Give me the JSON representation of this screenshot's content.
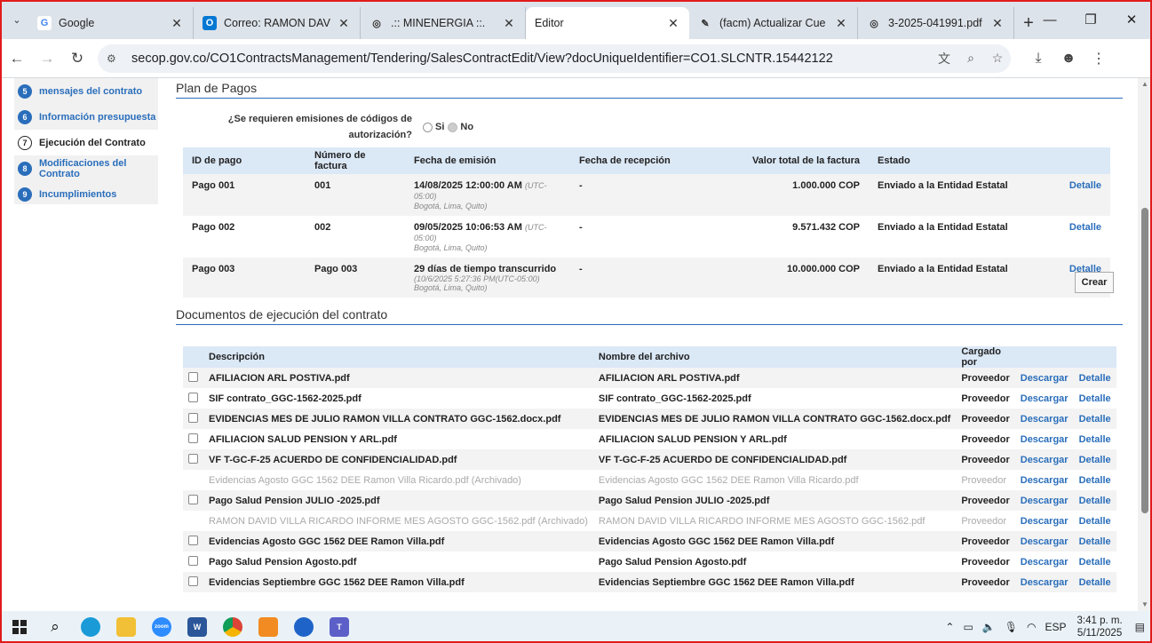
{
  "browser": {
    "tabs": [
      {
        "title": "Google",
        "favicon": "google-icon",
        "active": false
      },
      {
        "title": "Correo: RAMON DAV",
        "favicon": "outlook-icon",
        "active": false
      },
      {
        "title": ".:: MINENERGIA ::.",
        "favicon": "globe-icon",
        "active": false
      },
      {
        "title": "Editor",
        "favicon": "",
        "active": true
      },
      {
        "title": "(facm) Actualizar Cue",
        "favicon": "feather-icon",
        "active": false
      },
      {
        "title": "3-2025-041991.pdf",
        "favicon": "globe-icon",
        "active": false
      }
    ],
    "url": "secop.gov.co/CO1ContractsManagement/Tendering/SalesContractEdit/View?docUniqueIdentifier=CO1.SLCNTR.15442122"
  },
  "sidebar": {
    "steps": [
      {
        "num": "5",
        "label": "mensajes del contrato",
        "current": false
      },
      {
        "num": "6",
        "label": "Información presupuesta",
        "current": false
      },
      {
        "num": "7",
        "label": "Ejecución del Contrato",
        "current": true
      },
      {
        "num": "8",
        "label": "Modificaciones del Contrato",
        "current": false
      },
      {
        "num": "9",
        "label": "Incumplimientos",
        "current": false
      }
    ]
  },
  "plan_pagos": {
    "title": "Plan de Pagos",
    "question_line1": "¿Se requieren emisiones de códigos de",
    "question_line2": "autorización?",
    "opt_si": "Si",
    "opt_no": "No",
    "headers": [
      "ID de pago",
      "Número de factura",
      "Fecha de emisión",
      "Fecha de recepción",
      "Valor total de la factura",
      "Estado"
    ],
    "rows": [
      {
        "id": "Pago 001",
        "factura": "001",
        "fecha": "14/08/2025 12:00:00 AM",
        "tz": "(UTC-05:00)",
        "sub": "Bogotá, Lima, Quito)",
        "sub2": "",
        "recepcion": "-",
        "valor": "1.000.000 COP",
        "estado": "Enviado a la Entidad Estatal",
        "detalle": "Detalle"
      },
      {
        "id": "Pago 002",
        "factura": "002",
        "fecha": "09/05/2025 10:06:53 AM",
        "tz": "(UTC-05:00)",
        "sub": "Bogotá, Lima, Quito)",
        "sub2": "",
        "recepcion": "-",
        "valor": "9.571.432 COP",
        "estado": "Enviado a la Entidad Estatal",
        "detalle": "Detalle"
      },
      {
        "id": "Pago 003",
        "factura": "Pago 003",
        "fecha": "29 días de tiempo transcurrido",
        "tz": "",
        "sub": "(10/6/2025 5:27:36 PM(UTC-05:00)",
        "sub2": "Bogotá, Lima, Quito)",
        "recepcion": "-",
        "valor": "10.000.000 COP",
        "estado": "Enviado a la Entidad Estatal",
        "detalle": "Detalle"
      }
    ],
    "crear": "Crear"
  },
  "documentos": {
    "title": "Documentos de ejecución del contrato",
    "headers": [
      "Descripción",
      "Nombre del archivo",
      "Cargado por"
    ],
    "rows": [
      {
        "desc": "AFILIACION ARL POSTIVA.pdf",
        "file": "AFILIACION ARL POSTIVA.pdf",
        "by": "Proveedor",
        "archived": false
      },
      {
        "desc": "SIF contrato_GGC-1562-2025.pdf",
        "file": "SIF contrato_GGC-1562-2025.pdf",
        "by": "Proveedor",
        "archived": false
      },
      {
        "desc": "EVIDENCIAS MES DE JULIO RAMON VILLA CONTRATO GGC-1562.docx.pdf",
        "file": "EVIDENCIAS MES DE JULIO RAMON VILLA CONTRATO GGC-1562.docx.pdf",
        "by": "Proveedor",
        "archived": false
      },
      {
        "desc": "AFILIACION SALUD PENSION Y ARL.pdf",
        "file": "AFILIACION SALUD PENSION Y ARL.pdf",
        "by": "Proveedor",
        "archived": false
      },
      {
        "desc": "VF T-GC-F-25 ACUERDO DE CONFIDENCIALIDAD.pdf",
        "file": "VF T-GC-F-25 ACUERDO DE CONFIDENCIALIDAD.pdf",
        "by": "Proveedor",
        "archived": false
      },
      {
        "desc": "Evidencias Agosto GGC 1562 DEE Ramon Villa Ricardo.pdf (Archivado)",
        "file": "Evidencias Agosto GGC 1562 DEE Ramon Villa Ricardo.pdf",
        "by": "Proveedor",
        "archived": true
      },
      {
        "desc": "Pago Salud Pension JULIO -2025.pdf",
        "file": "Pago Salud Pension JULIO -2025.pdf",
        "by": "Proveedor",
        "archived": false
      },
      {
        "desc": "RAMON DAVID VILLA RICARDO INFORME MES AGOSTO GGC-1562.pdf (Archivado)",
        "file": "RAMON DAVID VILLA RICARDO INFORME MES AGOSTO GGC-1562.pdf",
        "by": "Proveedor",
        "archived": true
      },
      {
        "desc": "Evidencias Agosto GGC 1562 DEE Ramon Villa.pdf",
        "file": "Evidencias Agosto GGC 1562 DEE Ramon Villa.pdf",
        "by": "Proveedor",
        "archived": false
      },
      {
        "desc": "Pago Salud Pension Agosto.pdf",
        "file": "Pago Salud Pension Agosto.pdf",
        "by": "Proveedor",
        "archived": false
      },
      {
        "desc": "Evidencias Septiembre GGC 1562 DEE Ramon Villa.pdf",
        "file": "Evidencias Septiembre GGC 1562 DEE Ramon Villa.pdf",
        "by": "Proveedor",
        "archived": false
      }
    ],
    "descargar": "Descargar",
    "detalle": "Detalle"
  },
  "taskbar": {
    "lang": "ESP",
    "time": "3:41 p. m.",
    "date": "5/11/2025"
  },
  "colors": {
    "accent": "#2a6ebb",
    "header_bg": "#dbe8f6",
    "frame": "#e21b1b"
  }
}
